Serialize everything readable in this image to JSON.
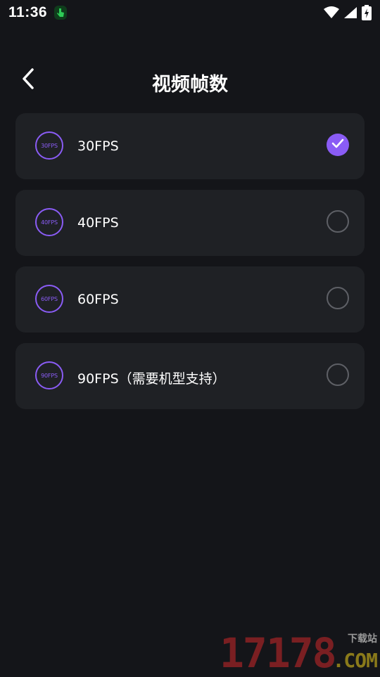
{
  "status_bar": {
    "time": "11:36"
  },
  "header": {
    "title": "视频帧数"
  },
  "options": [
    {
      "badge": "30FPS",
      "label": "30FPS",
      "selected": true
    },
    {
      "badge": "40FPS",
      "label": "40FPS",
      "selected": false
    },
    {
      "badge": "60FPS",
      "label": "60FPS",
      "selected": false
    },
    {
      "badge": "90FPS",
      "label": "90FPS（需要机型支持）",
      "selected": false
    }
  ],
  "watermark": {
    "digits": "17178",
    "site": "下载站",
    "domain": ".COM"
  },
  "colors": {
    "background": "#141519",
    "card": "#1f2125",
    "accent": "#8a5cf5"
  }
}
